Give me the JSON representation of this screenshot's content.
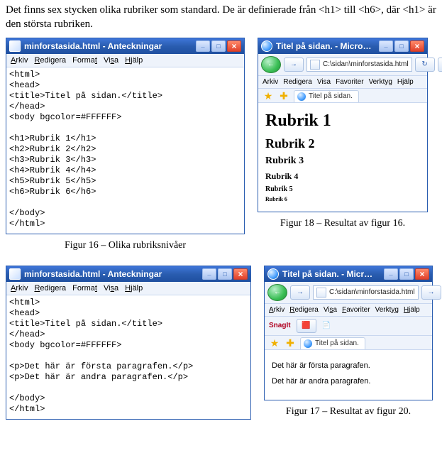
{
  "intro": "Det finns sex stycken olika rubriker som standard. De är definierade från <h1> till <h6>, där <h1> är den största rubriken.",
  "notepad1": {
    "title": "minforstasida.html - Anteckningar",
    "menu": {
      "arkiv": "Arkiv",
      "redigera": "Redigera",
      "format": "Format",
      "visa": "Visa",
      "hjalp": "Hjälp"
    },
    "code": "<html>\n<head>\n<title>Titel på sidan.</title>\n</head>\n<body bgcolor=#FFFFFF>\n\n<h1>Rubrik 1</h1>\n<h2>Rubrik 2</h2>\n<h3>Rubrik 3</h3>\n<h4>Rubrik 4</h4>\n<h5>Rubrik 5</h5>\n<h6>Rubrik 6</h6>\n\n</body>\n</html>"
  },
  "caption16": "Figur 16 – Olika rubriksnivåer",
  "ie1": {
    "title": "Titel på sidan. - Microsoft Internet Explorer",
    "address": "C:\\sidan\\minforstasida.html",
    "menu": {
      "arkiv": "Arkiv",
      "redigera": "Redigera",
      "visa": "Visa",
      "favoriter": "Favoriter",
      "verktyg": "Verktyg",
      "hjalp": "Hjälp"
    },
    "tab": "Titel på sidan.",
    "h1": "Rubrik 1",
    "h2": "Rubrik 2",
    "h3": "Rubrik 3",
    "h4": "Rubrik 4",
    "h5": "Rubrik 5",
    "h6": "Rubrik 6"
  },
  "caption18": "Figur 18 – Resultat av figur 16.",
  "notepad2": {
    "title": "minforstasida.html - Anteckningar",
    "menu": {
      "arkiv": "Arkiv",
      "redigera": "Redigera",
      "format": "Format",
      "visa": "Visa",
      "hjalp": "Hjälp"
    },
    "code": "<html>\n<head>\n<title>Titel på sidan.</title>\n</head>\n<body bgcolor=#FFFFFF>\n\n<p>Det här är första paragrafen.</p>\n<p>Det här är andra paragrafen.</p>\n\n</body>\n</html>"
  },
  "ie2": {
    "title": "Titel på sidan. - Microsoft Internet Explorer",
    "address": "C:\\sidan\\minforstasida.html",
    "menu": {
      "arkiv": "Arkiv",
      "redigera": "Redigera",
      "visa": "Visa",
      "favoriter": "Favoriter",
      "verktyg": "Verktyg",
      "hjalp": "Hjälp"
    },
    "snagit": "SnagIt",
    "tab": "Titel på sidan.",
    "p1": "Det här är första paragrafen.",
    "p2": "Det här är andra paragrafen."
  },
  "caption17": "Figur 17 – Resultat av figur 20."
}
